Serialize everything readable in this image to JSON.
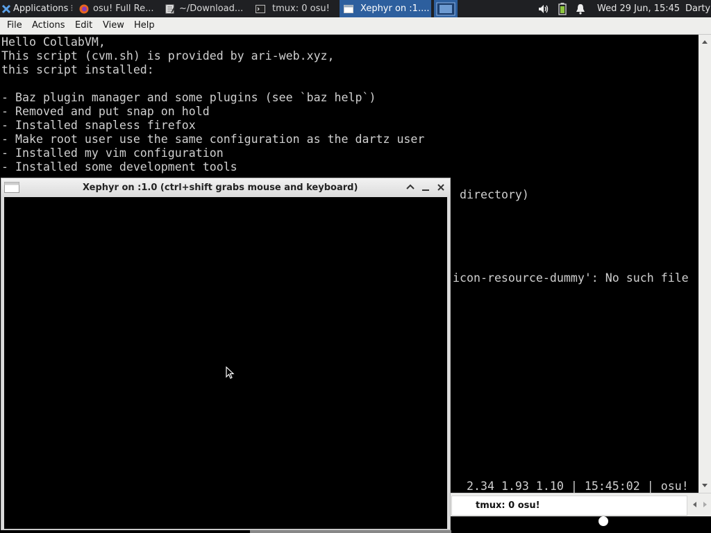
{
  "panel": {
    "applications_label": "Applications",
    "tasks": [
      {
        "label": "osu! Full Re...",
        "icon": "firefox-icon"
      },
      {
        "label": "~/Download...",
        "icon": "text-editor-icon"
      },
      {
        "label": "tmux: 0 osu!",
        "icon": "terminal-icon"
      },
      {
        "label": "Xephyr on :1....",
        "icon": "window-icon",
        "active": true
      }
    ],
    "clock": "Wed 29 Jun, 15:45",
    "user": "Darty"
  },
  "terminal": {
    "menu": [
      "File",
      "Actions",
      "Edit",
      "View",
      "Help"
    ],
    "lines": [
      "Hello CollabVM,",
      "This script (cvm.sh) is provided by ari-web.xyz,",
      "this script installed:",
      "",
      "- Baz plugin manager and some plugins (see `baz help`)",
      "- Removed and put snap on hold",
      "- Installed snapless firefox",
      "- Make root user use the same configuration as the dartz user",
      "- Installed my vim configuration",
      "- Installed some development tools"
    ],
    "partial_lines": {
      "line12": "directory)",
      "line18": "icon-resource-dummy': No such file",
      "status": "2.34 1.93 1.10 | 15:45:02 | osu!"
    },
    "tab_label": "tmux: 0 osu!"
  },
  "xephyr": {
    "title": "Xephyr on :1.0 (ctrl+shift grabs mouse and keyboard)"
  },
  "colors": {
    "panel_bg": "#1f2023",
    "active_task": "#2d5f9e",
    "terminal_bg": "#000000",
    "terminal_fg": "#d0d0d0"
  }
}
